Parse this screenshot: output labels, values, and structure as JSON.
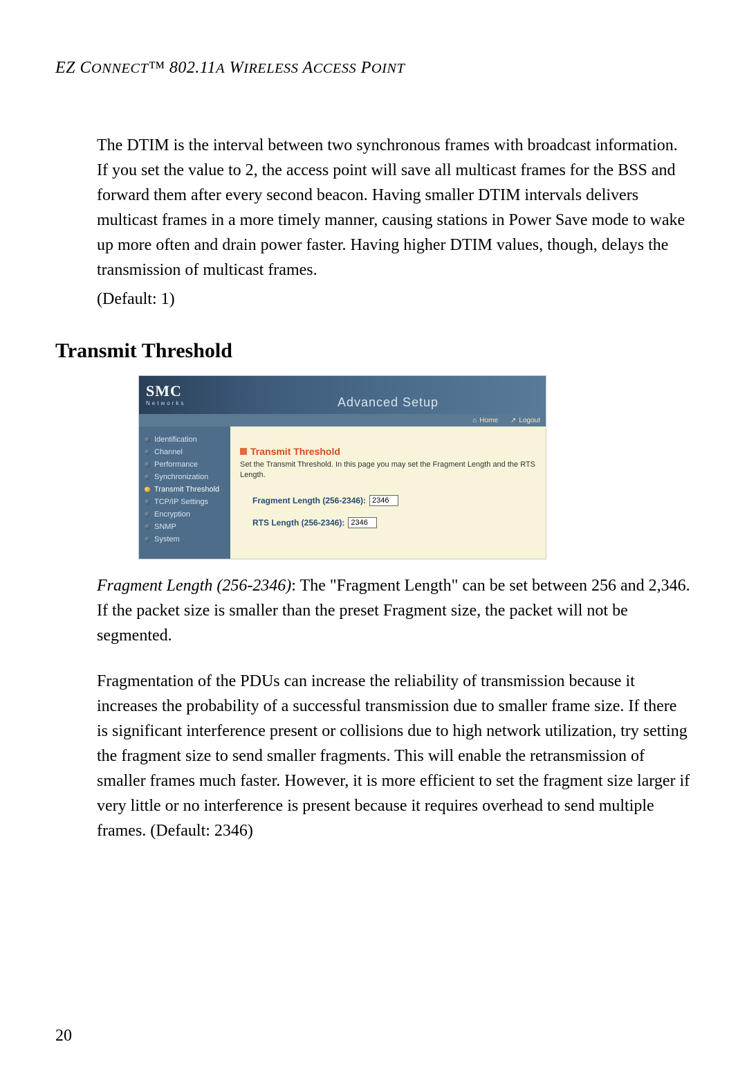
{
  "header": {
    "title": "EZ Connect™ 802.11a Wireless Access Point"
  },
  "intro": {
    "paragraph": "The DTIM is the interval between two synchronous frames with broadcast information. If you set the value to 2, the access point will save all multicast frames for the BSS and forward them after every second beacon. Having smaller DTIM intervals delivers multicast frames in a more timely manner, causing stations in Power Save mode to wake up more often and drain power faster. Having higher DTIM values, though, delays the transmission of multicast frames.",
    "default_line": "(Default: 1)"
  },
  "section": {
    "heading": "Transmit Threshold"
  },
  "screenshot": {
    "logo": "SMC",
    "logo_sub": "Networks",
    "banner": "Advanced Setup",
    "topbar": {
      "home": "Home",
      "logout": "Logout"
    },
    "nav": [
      {
        "label": "Identification",
        "active": false
      },
      {
        "label": "Channel",
        "active": false
      },
      {
        "label": "Performance",
        "active": false
      },
      {
        "label": "Synchronization",
        "active": false
      },
      {
        "label": "Transmit Threshold",
        "active": true
      },
      {
        "label": "TCP/IP Settings",
        "active": false
      },
      {
        "label": "Encryption",
        "active": false
      },
      {
        "label": "SNMP",
        "active": false
      },
      {
        "label": "System",
        "active": false
      }
    ],
    "content": {
      "title": "Transmit Threshold",
      "desc": "Set the Transmit Threshold. In this page you may set the Fragment Length and the RTS Length.",
      "fragment_label": "Fragment Length (256-2346):",
      "fragment_value": "2346",
      "rts_label": "RTS Length (256-2346):",
      "rts_value": "2346"
    }
  },
  "below": {
    "p1_lead": "Fragment Length (256-2346)",
    "p1_rest": ": The \"Fragment Length\" can be set between 256 and 2,346. If the packet size is smaller than the preset Fragment size, the packet will not be segmented.",
    "p2": "Fragmentation of the PDUs can increase the reliability of transmission because it increases the probability of a successful transmission due to smaller frame size. If there is significant interference present or collisions due to high network utilization, try setting the fragment size to send smaller fragments. This will enable the retransmission of smaller frames much faster. However, it is more efficient to set the fragment size larger if very little or no interference is present because it requires overhead to send multiple frames. (Default: 2346)"
  },
  "page_number": "20"
}
